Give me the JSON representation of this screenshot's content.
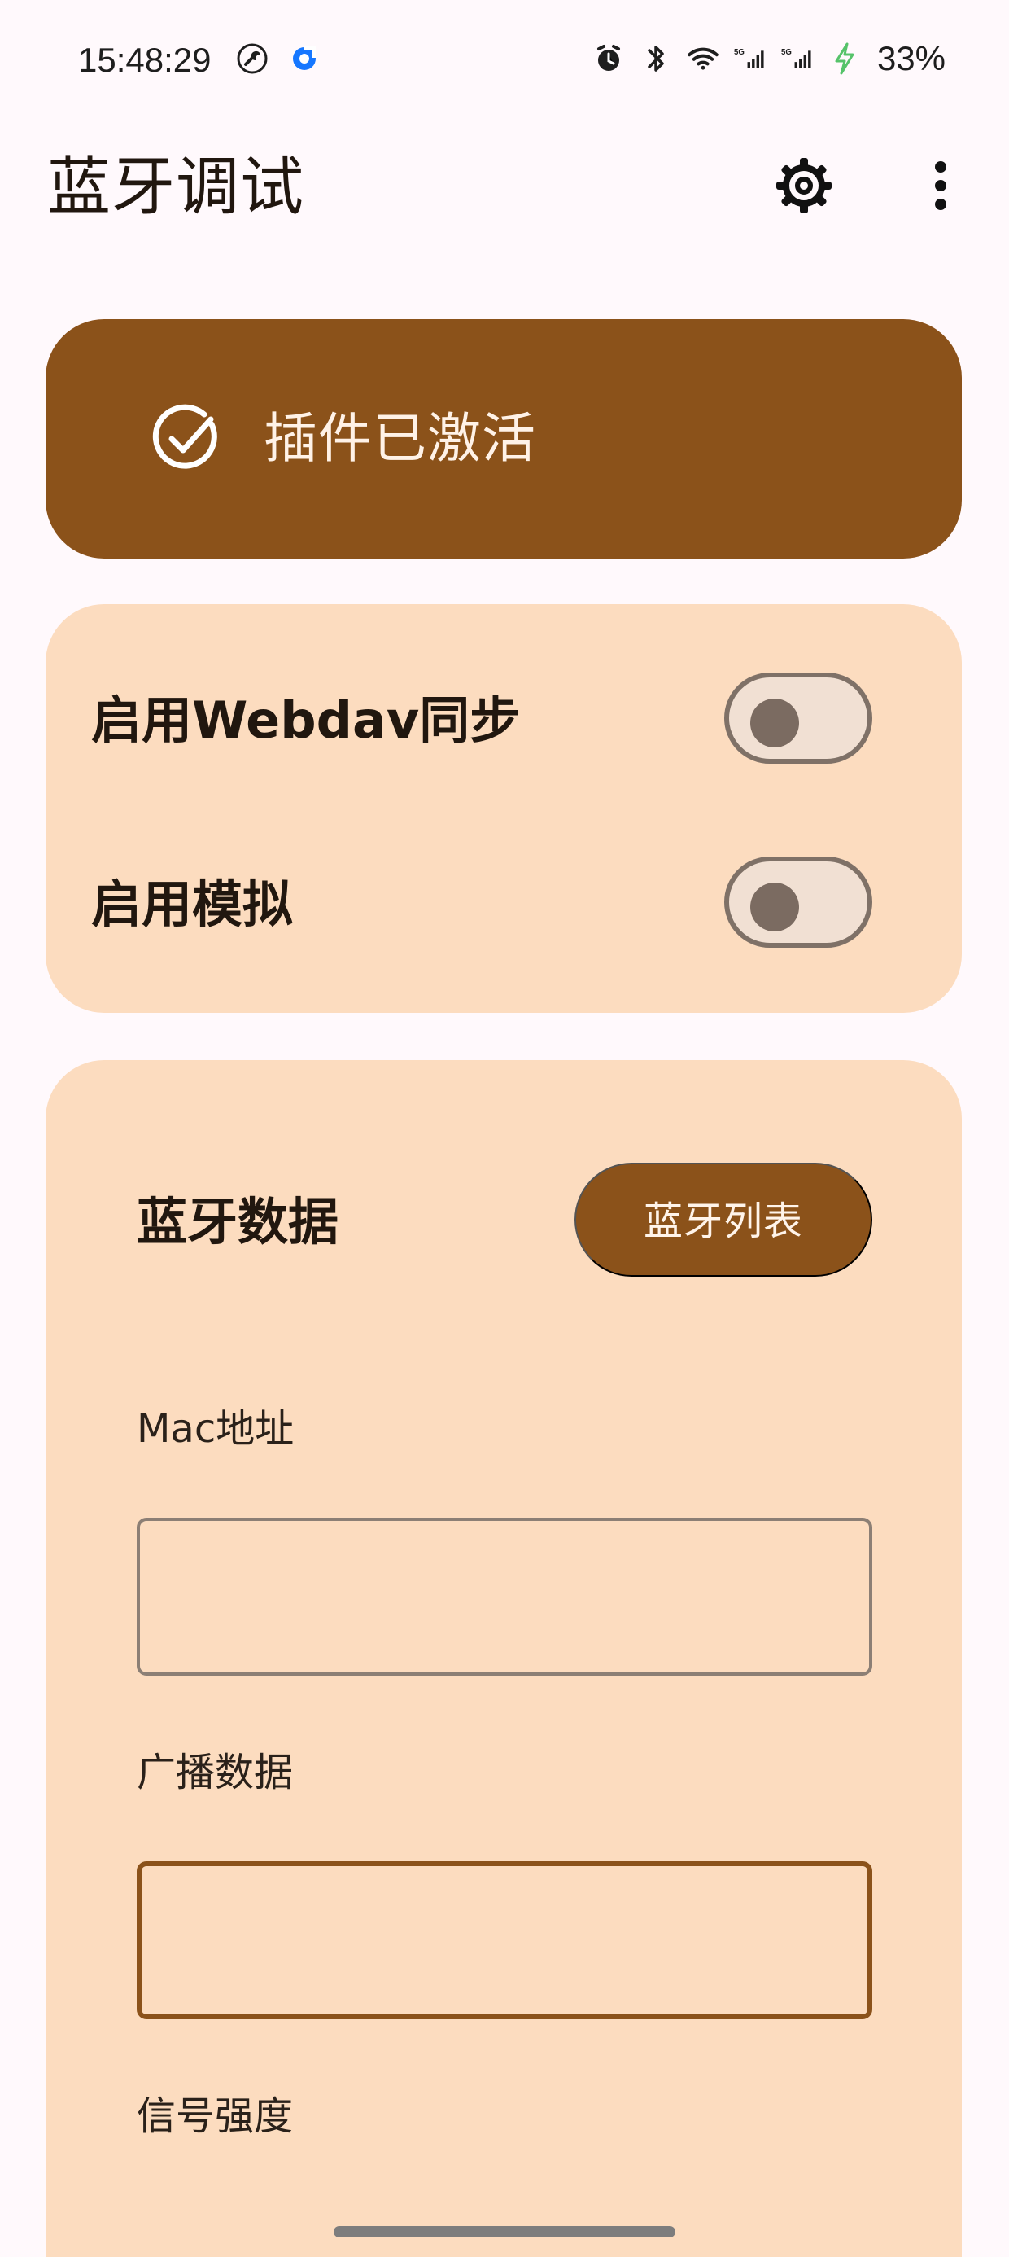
{
  "status_bar": {
    "time": "15:48:29",
    "battery": "33%",
    "icons": {
      "left": [
        "wrench-icon",
        "blue-circle-icon"
      ],
      "right": [
        "alarm-icon",
        "bluetooth-icon",
        "wifi-icon",
        "signal-5g-icon",
        "signal-5g-icon",
        "charging-icon"
      ]
    }
  },
  "app_bar": {
    "title": "蓝牙调试",
    "actions": [
      "gear-icon",
      "more-vert-icon"
    ]
  },
  "plugin_status": {
    "icon": "check-circle-icon",
    "text": "插件已激活"
  },
  "toggles": [
    {
      "label": "启用Webdav同步",
      "enabled": false
    },
    {
      "label": "启用模拟",
      "enabled": false
    }
  ],
  "bluetooth_data": {
    "title": "蓝牙数据",
    "button_label": "蓝牙列表",
    "fields": {
      "mac": {
        "label": "Mac地址",
        "value": "",
        "placeholder": ""
      },
      "advertising": {
        "label": "广播数据",
        "value": "",
        "placeholder": ""
      },
      "rssi": {
        "label": "信号强度"
      }
    }
  },
  "colors": {
    "primary": "#8B521A",
    "surface_container": "#FCDCBF",
    "background": "#FFF9FC",
    "outline": "#7F7167",
    "on_primary": "#FFFFFF",
    "charging_green": "#56C36A",
    "signal_blue": "#2563EB"
  }
}
